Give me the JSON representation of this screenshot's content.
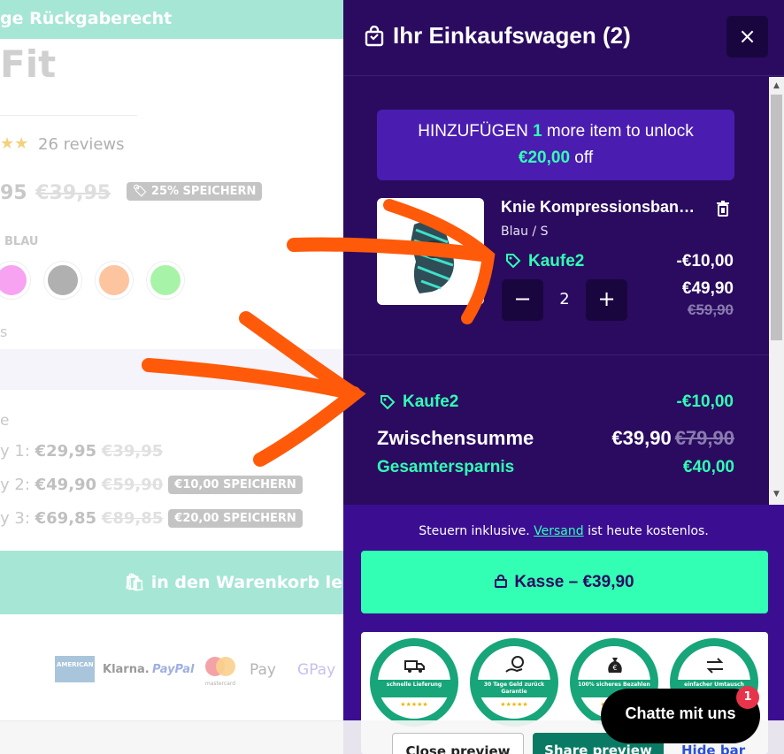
{
  "background": {
    "banner": "ge Rückgaberecht",
    "product_title": "Fit",
    "stars": "★★",
    "reviews": "26 reviews",
    "price_now": "95",
    "price_was": "€39,95",
    "save_badge": "25% SPEICHERN",
    "color_label": "BLAU",
    "size_label": "s",
    "qty_label": "e",
    "tiers": [
      {
        "label": "y 1: ",
        "price": "€29,95",
        "old": "€39,95",
        "badge": ""
      },
      {
        "label": "y 2: ",
        "price": "€49,90",
        "old": "€59,90",
        "badge": "€10,00 SPEICHERN"
      },
      {
        "label": "y 3: ",
        "price": "€69,85",
        "old": "€89,85",
        "badge": "€20,00 SPEICHERN"
      }
    ],
    "add_to_cart": "in den Warenkorb leg",
    "payments": {
      "amex": "AMERICAN EXPRESS",
      "klarna": "Klarna.",
      "paypal": "PayPal",
      "mastercard": "mastercard",
      "apple": "Pay",
      "gpay": "Pay"
    }
  },
  "drawer": {
    "title": "Ihr Einkaufswagen (2)",
    "close": "×",
    "unlock": {
      "prefix": "HINZUFÜGEN ",
      "count": "1",
      "middle": " more item to unlock",
      "amount": "€20,00",
      "suffix": " off"
    },
    "item": {
      "name": "Knie Kompressionsbandage",
      "variant": "Blau / S",
      "discount_code": "Kaufe2",
      "discount_amount": "-€10,00",
      "qty_minus": "−",
      "qty": "2",
      "qty_plus": "+",
      "price": "€49,90",
      "old_price": "€59,90"
    },
    "cart_discount": {
      "code": "Kaufe2",
      "amount": "-€10,00"
    },
    "subtotal": {
      "label": "Zwischensumme",
      "value": "€39,90",
      "old": "€79,90"
    },
    "savings": {
      "label": "Gesamtersparnis",
      "value": "€40,00"
    },
    "tax_note": {
      "before": "Steuern inklusive. ",
      "link": "Versand",
      "after": " ist heute kostenlos."
    },
    "checkout": "Kasse – €39,90",
    "trust_badges": [
      {
        "icon": "truck-icon",
        "text": "schnelle Lieferung"
      },
      {
        "icon": "money-hand-icon",
        "text": "30 Tage Geld zurück Garantie"
      },
      {
        "icon": "money-bag-icon",
        "text": "100% sicheres Bezahlen"
      },
      {
        "icon": "exchange-icon",
        "text": "einfacher Umtausch"
      }
    ],
    "badge_stars": "★★★★★"
  },
  "chat": {
    "label": "Chatte mit uns",
    "count": "1"
  },
  "preview_bar": {
    "close": "Close preview",
    "share": "Share preview",
    "hide": "Hide bar"
  },
  "colors": {
    "drawer_bg": "#2a0b60",
    "accent": "#32ffb4",
    "unlock_bg": "#4a1db0",
    "footer_bg": "#3b0e91",
    "annotation": "#ff5a0a"
  }
}
